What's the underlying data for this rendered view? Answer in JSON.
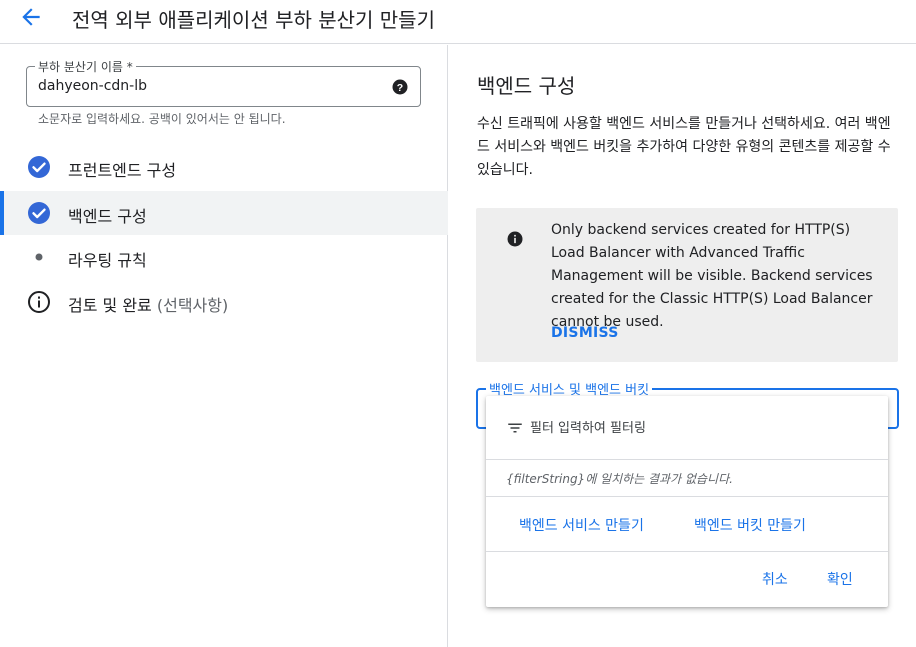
{
  "header": {
    "title": "전역 외부 애플리케이션 부하 분산기 만들기",
    "back_icon": "arrow-back-icon"
  },
  "left": {
    "name_field": {
      "label": "부하 분산기 이름 *",
      "value": "dahyeon-cdn-lb",
      "hint": "소문자로 입력하세요. 공백이 있어서는 안 됩니다."
    },
    "steps": [
      {
        "label": "프런트엔드 구성",
        "icon": "check-circle-icon",
        "status": "done"
      },
      {
        "label": "백엔드 구성",
        "icon": "check-circle-icon",
        "status": "active"
      },
      {
        "label": "라우팅 규칙",
        "icon": "dot-icon",
        "status": "pending"
      },
      {
        "label": "검토 및 완료",
        "optional": "(선택사항)",
        "icon": "info-outline-icon",
        "status": "pending"
      }
    ]
  },
  "right": {
    "title": "백엔드 구성",
    "description": "수신 트래픽에 사용할 백엔드 서비스를 만들거나 선택하세요. 여러 백엔드 서비스와 백엔드 버킷을 추가하여 다양한 유형의 콘텐츠를 제공할 수 있습니다.",
    "info_box": {
      "text": "Only backend services created for HTTP(S) Load Balancer with Advanced Traffic Management will be visible. Backend services created for the Classic HTTP(S) Load Balancer cannot be used.",
      "dismiss": "DISMISS"
    },
    "backend_select": {
      "label": "백엔드 서비스 및 백엔드 버킷"
    }
  },
  "dropdown": {
    "filter_placeholder": "필터 입력하여 필터링",
    "empty_text": "{filterString}에 일치하는 결과가 없습니다.",
    "create_service": "백엔드 서비스 만들기",
    "create_bucket": "백엔드 버킷 만들기",
    "cancel": "취소",
    "confirm": "확인"
  },
  "colors": {
    "accent": "#1a73e8",
    "step_done": "#3367d6",
    "info_bg": "#eeeeee"
  }
}
